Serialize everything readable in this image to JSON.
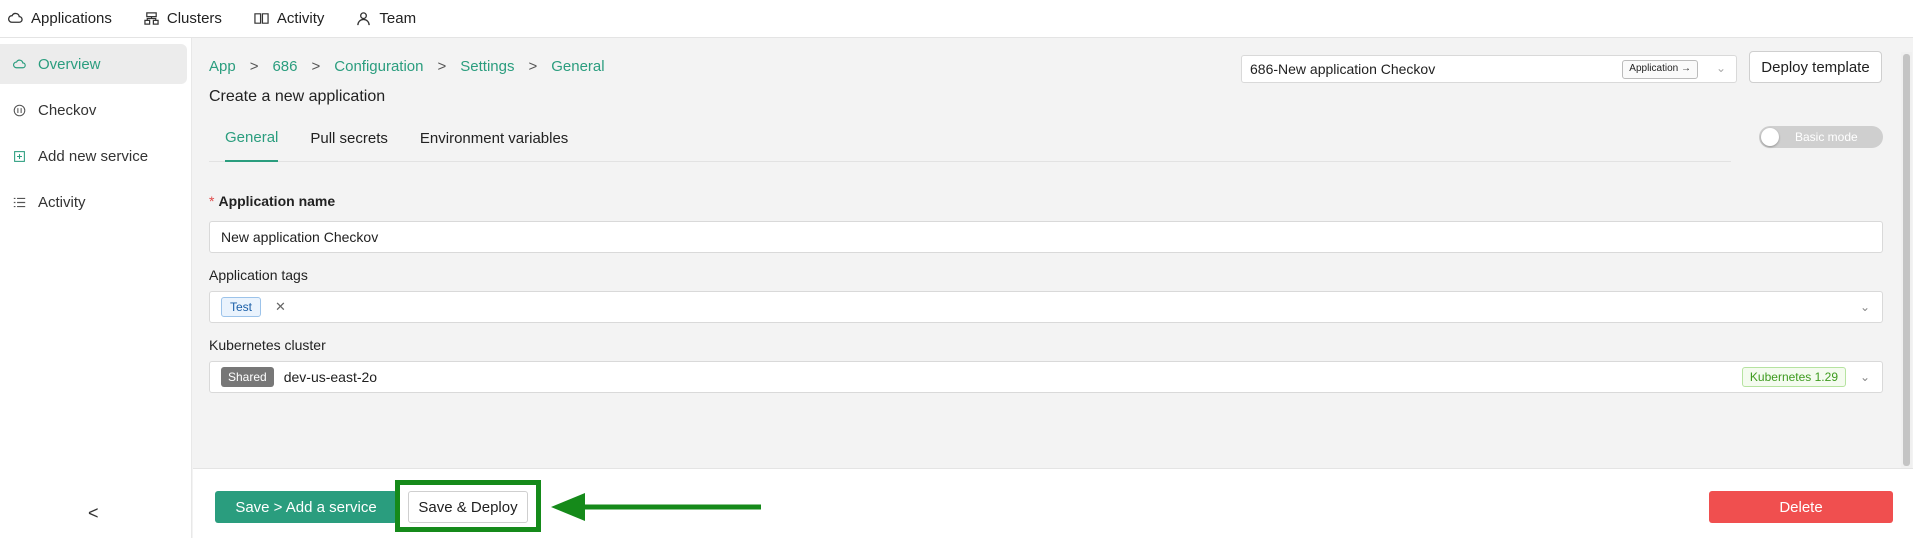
{
  "topnav": [
    {
      "label": "Applications",
      "icon": "cloud-icon"
    },
    {
      "label": "Clusters",
      "icon": "clusters-icon"
    },
    {
      "label": "Activity",
      "icon": "activity-icon"
    },
    {
      "label": "Team",
      "icon": "team-icon"
    }
  ],
  "sidebar": {
    "items": [
      {
        "label": "Overview",
        "icon": "overview-icon",
        "active": true
      },
      {
        "label": "Checkov",
        "icon": "checkov-icon"
      },
      {
        "label": "Add new service",
        "icon": "add-service-icon"
      },
      {
        "label": "Activity",
        "icon": "list-icon"
      }
    ],
    "collapse": "<"
  },
  "breadcrumb": [
    "App",
    "686",
    "Configuration",
    "Settings",
    "General"
  ],
  "breadcrumb_sep": ">",
  "page_title": "Create a new application",
  "app_select": {
    "value": "686-New application Checkov",
    "tag": "Application →"
  },
  "deploy_template": "Deploy template",
  "tabs": [
    "General",
    "Pull secrets",
    "Environment variables"
  ],
  "mode_toggle": {
    "label": "Basic mode",
    "on": false
  },
  "form": {
    "name_label": "Application name",
    "name_value": "New application Checkov",
    "tags_label": "Application tags",
    "tags": [
      "Test"
    ],
    "cluster_label": "Kubernetes cluster",
    "cluster_badge": "Shared",
    "cluster_value": "dev-us-east-2o",
    "cluster_version": "Kubernetes 1.29"
  },
  "footer": {
    "save_add": "Save > Add a service",
    "save_deploy": "Save & Deploy",
    "delete": "Delete"
  },
  "colors": {
    "accent": "#2a9d7e",
    "danger": "#f04f4f",
    "highlight": "#158a1a"
  }
}
